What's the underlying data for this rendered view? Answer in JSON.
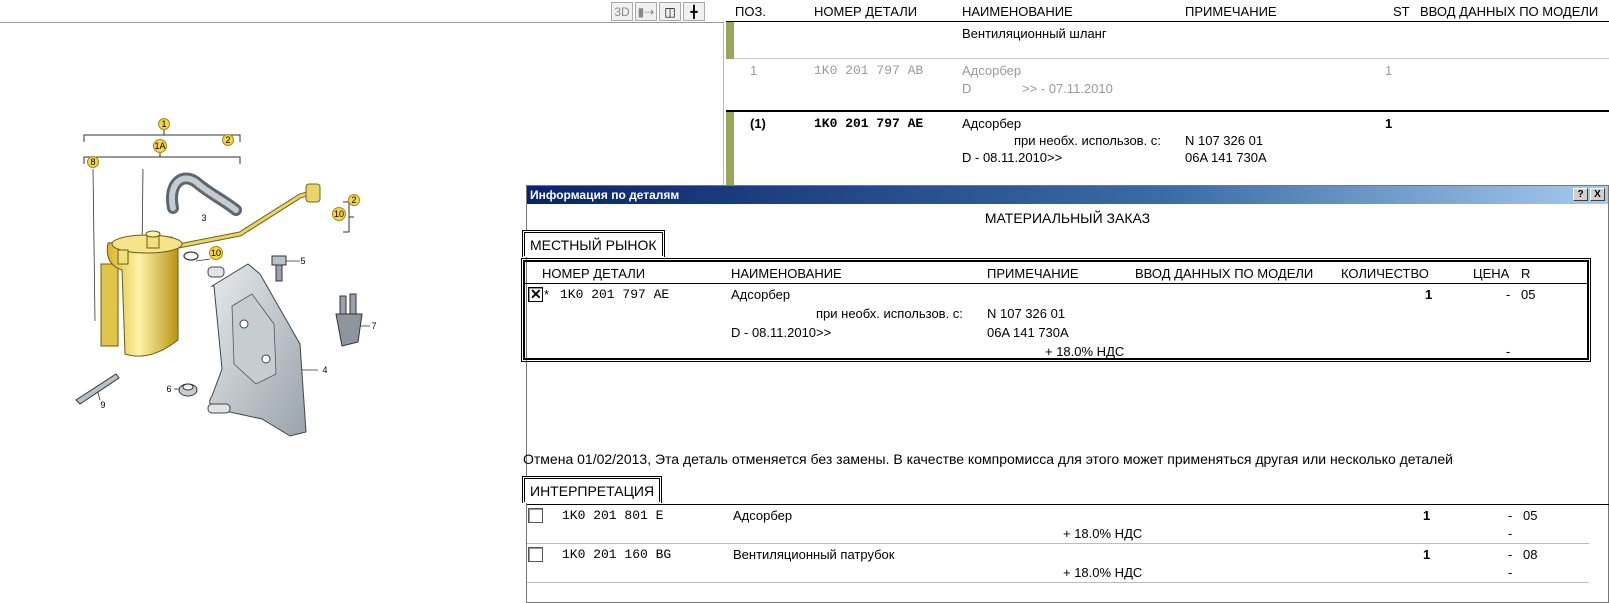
{
  "diagram": {
    "toolbar": {
      "btn_3d": "3D",
      "btn_a": "▮⇢",
      "btn_b": "◫",
      "btn_c": "╋"
    },
    "callouts": [
      "1",
      "1A",
      "2",
      "8",
      "3",
      "10",
      "2",
      "10",
      "5",
      "7",
      "4",
      "6",
      "9"
    ]
  },
  "parts_table": {
    "headers": {
      "pos": "ПОЗ.",
      "part_no": "НОМЕР ДЕТАЛИ",
      "name": "НАИМЕНОВАНИЕ",
      "note": "ПРИМЕЧАНИЕ",
      "st": "ST",
      "model": "ВВОД ДАННЫХ ПО МОДЕЛИ"
    },
    "group_row": {
      "name": "Вентиляционный шланг"
    },
    "row_grey": {
      "pos": "1",
      "part_no": "1K0 201 797 AB",
      "name": "Адсорбер",
      "st": "1",
      "model_code": "D",
      "date": ">> - 07.11.2010"
    },
    "row_selected": {
      "pos": "(1)",
      "part_no": "1K0 201 797 AE",
      "name": "Адсорбер",
      "st": "1",
      "note_label": "при необх. использов. с:",
      "note_value_1": "N 107 326 01",
      "date": "D - 08.11.2010>>",
      "note_value_2": "06A 141 730A"
    }
  },
  "dialog": {
    "title": "Информация по деталям",
    "help_btn": "?",
    "close_btn": "X",
    "heading": "МАТЕРИАЛЬНЫЙ ЗАКАЗ",
    "market_tab": "МЕСТНЫЙ РЫНОК",
    "market_headers": {
      "part_no": "НОМЕР ДЕТАЛИ",
      "name": "НАИМЕНОВАНИЕ",
      "note": "ПРИМЕЧАНИЕ",
      "model": "ВВОД ДАННЫХ ПО МОДЕЛИ",
      "qty": "КОЛИЧЕСТВО",
      "price": "ЦЕНА",
      "r": "R"
    },
    "market_row": {
      "checked": true,
      "star": "*",
      "part_no": "1K0 201 797 AE",
      "name": "Адсорбер",
      "qty": "1",
      "price": "-",
      "r": "05",
      "note_label": "при необх. использов. с:",
      "note_value_1": "N 107 326 01",
      "date": "D - 08.11.2010>>",
      "note_value_2": "06A 141 730A",
      "vat": "+ 18.0% НДС",
      "vat_price": "-"
    },
    "cancel_note": "Отмена 01/02/2013, Эта деталь отменяется без замены. В качестве компромисса для этого может применяться другая или несколько деталей",
    "interp_tab": "ИНТЕРПРЕТАЦИЯ",
    "interp_rows": [
      {
        "part_no": "1K0 201 801 E",
        "name": "Адсорбер",
        "qty": "1",
        "price": "-",
        "r": "05",
        "vat": "+ 18.0% НДС",
        "vat_price": "-"
      },
      {
        "part_no": "1K0 201 160 BG",
        "name": "Вентиляционный патрубок",
        "qty": "1",
        "price": "-",
        "r": "08",
        "vat": "+ 18.0% НДС",
        "vat_price": "-"
      }
    ]
  }
}
